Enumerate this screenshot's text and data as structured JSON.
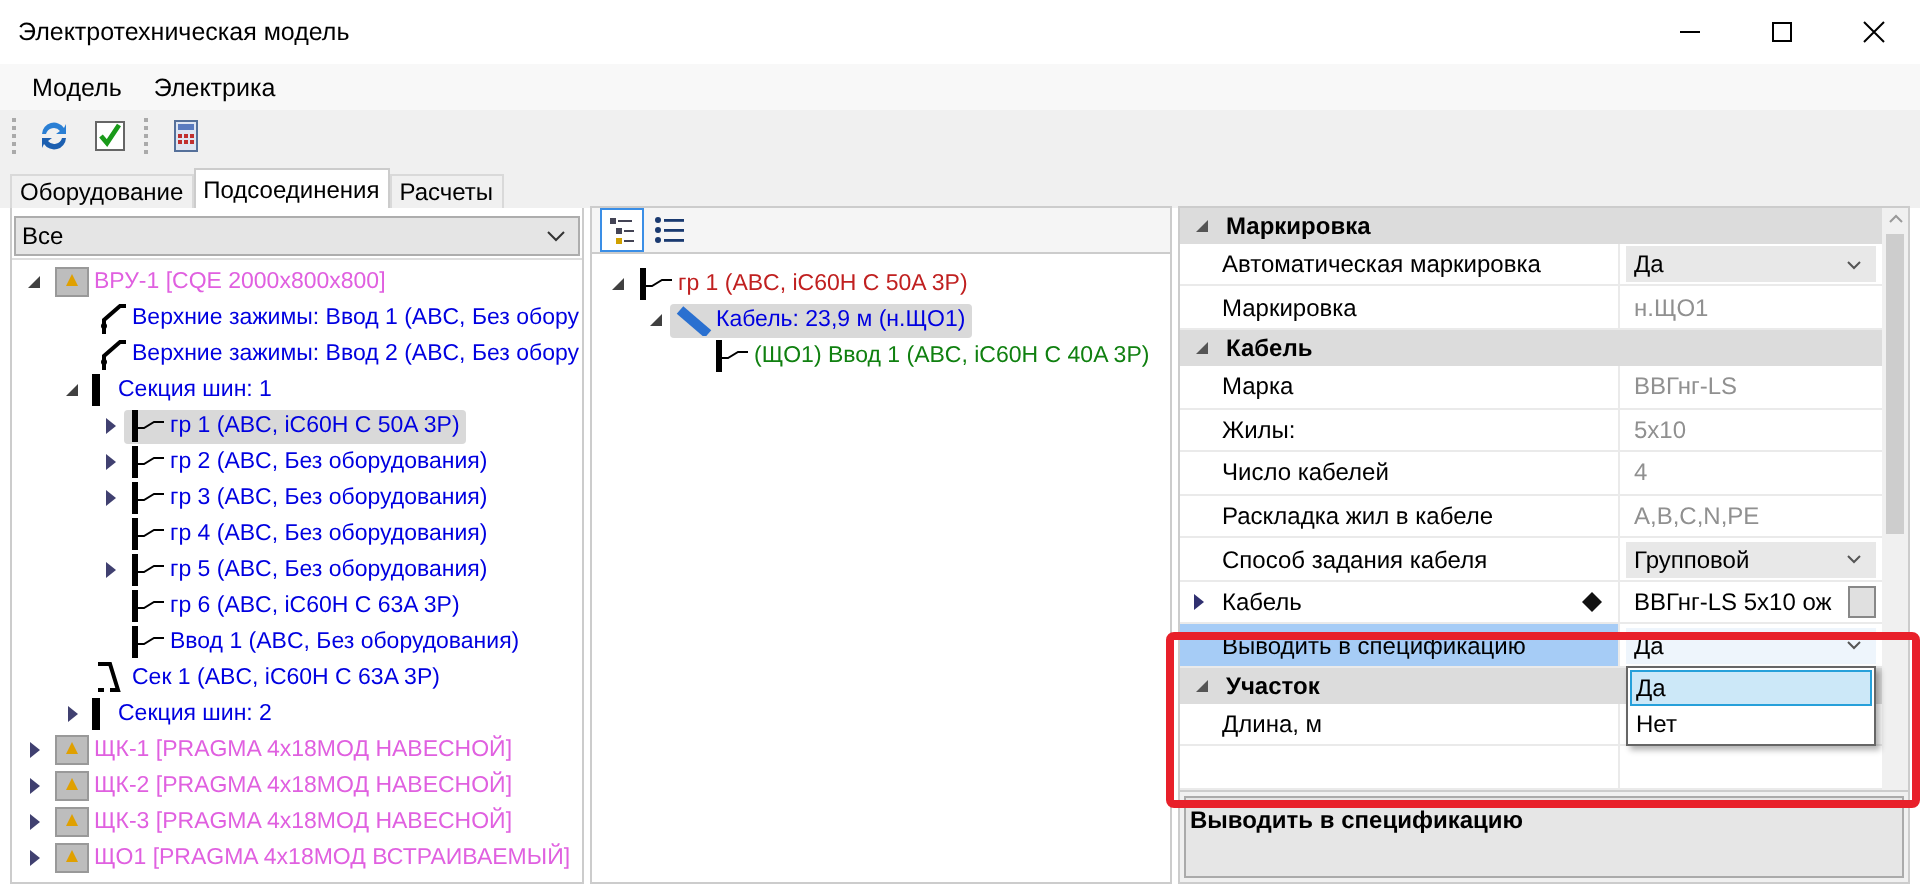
{
  "window": {
    "title": "Электротехническая модель"
  },
  "menu": [
    "Модель",
    "Электрика"
  ],
  "tabs": [
    {
      "label": "Оборудование",
      "selected": false
    },
    {
      "label": "Подсоединения",
      "selected": true
    },
    {
      "label": "Расчеты",
      "selected": false
    }
  ],
  "filter": {
    "value": "Все"
  },
  "equipment_tree": [
    {
      "label": "ВРУ-1 [CQE 2000x800x800]",
      "kind": "cabinet",
      "color": "#e060e0",
      "expanded": true,
      "selected": false,
      "children": [
        {
          "label": "Верхние зажимы: Ввод 1 (ABC, Без обору",
          "kind": "switch",
          "color": "#0000e0",
          "selected": false
        },
        {
          "label": "Верхние зажимы: Ввод 2 (ABC, Без обору",
          "kind": "switch",
          "color": "#0000e0",
          "selected": false
        },
        {
          "label": "Секция шин: 1",
          "kind": "busbar",
          "color": "#0000e0",
          "expanded": true,
          "selected": false,
          "children": [
            {
              "label": "гр 1 (ABC, iC60H C 50A 3P)",
              "kind": "breaker",
              "color": "#0000e0",
              "expanded": false,
              "selected": true
            },
            {
              "label": "гр 2 (ABC, Без оборудования)",
              "kind": "breaker",
              "color": "#0000e0",
              "expanded": false,
              "selected": false
            },
            {
              "label": "гр 3 (ABC, Без оборудования)",
              "kind": "breaker",
              "color": "#0000e0",
              "expanded": false,
              "selected": false
            },
            {
              "label": "гр 4 (ABC, Без оборудования)",
              "kind": "breaker",
              "color": "#0000e0",
              "selected": false
            },
            {
              "label": "гр 5 (ABC, Без оборудования)",
              "kind": "breaker",
              "color": "#0000e0",
              "expanded": false,
              "selected": false
            },
            {
              "label": "гр 6 (ABC, iC60H C 63A 3P)",
              "kind": "breaker",
              "color": "#0000e0",
              "selected": false
            },
            {
              "label": "Ввод 1 (ABC, Без оборудования)",
              "kind": "breaker",
              "color": "#0000e0",
              "selected": false
            }
          ]
        },
        {
          "label": "Сек 1 (ABC, iC60H C 63A 3P)",
          "kind": "sectionalizer",
          "color": "#0000e0",
          "selected": false
        },
        {
          "label": "Секция шин: 2",
          "kind": "busbar",
          "color": "#0000e0",
          "expanded": false,
          "selected": false
        }
      ]
    },
    {
      "label": "ЩК-1 [PRAGMA 4x18МОД НАВЕСНОЙ]",
      "kind": "cabinet",
      "color": "#e060e0",
      "expanded": false,
      "selected": false
    },
    {
      "label": "ЩК-2 [PRAGMA 4x18МОД НАВЕСНОЙ]",
      "kind": "cabinet",
      "color": "#e060e0",
      "expanded": false,
      "selected": false
    },
    {
      "label": "ЩК-3 [PRAGMA 4x18МОД НАВЕСНОЙ]",
      "kind": "cabinet",
      "color": "#e060e0",
      "expanded": false,
      "selected": false
    },
    {
      "label": "ЩО1 [PRAGMA 4x18МОД ВСТРАИВАЕМЫЙ]",
      "kind": "cabinet",
      "color": "#e060e0",
      "expanded": false,
      "selected": false
    }
  ],
  "connection_tree": [
    {
      "label": "гр 1 (ABC, iC60H C 50A 3P)",
      "kind": "breaker",
      "color": "#c02020",
      "expanded": true,
      "selected": false,
      "children": [
        {
          "label": "Кабель: 23,9 м (н.ЩО1)",
          "kind": "cable",
          "color": "#0000e0",
          "expanded": true,
          "selected": true,
          "children": [
            {
              "label": "(ЩО1) Ввод 1 (ABC, iC60H C 40A 3P)",
              "kind": "breaker",
              "color": "#108010",
              "selected": false
            }
          ]
        }
      ]
    }
  ],
  "properties": {
    "categories": [
      {
        "name": "Маркировка",
        "expanded": true,
        "rows": [
          {
            "name": "Автоматическая маркировка",
            "value": "Да",
            "kind": "dropdown",
            "selected": false,
            "open": false
          },
          {
            "name": "Маркировка",
            "value": "н.ЩО1",
            "kind": "text",
            "readonly": true,
            "selected": false
          }
        ]
      },
      {
        "name": "Кабель",
        "expanded": true,
        "rows": [
          {
            "name": "Марка",
            "value": "ВВГнг-LS",
            "kind": "text",
            "readonly": true,
            "selected": false
          },
          {
            "name": "Жилы:",
            "value": "5x10",
            "kind": "text",
            "readonly": true,
            "selected": false
          },
          {
            "name": "Число кабелей",
            "value": "4",
            "kind": "text",
            "readonly": true,
            "selected": false
          },
          {
            "name": "Раскладка жил в кабеле",
            "value": "A,B,C,N,PE",
            "kind": "text",
            "readonly": true,
            "selected": false
          },
          {
            "name": "Способ задания кабеля",
            "value": "Групповой",
            "kind": "dropdown",
            "selected": false,
            "open": false
          },
          {
            "name": "Кабель",
            "value": "ВВГнг-LS 5x10 ож",
            "kind": "object",
            "selected": false
          },
          {
            "name": "Выводить в спецификацию",
            "value": "Да",
            "kind": "dropdown",
            "selected": true,
            "open": true
          }
        ]
      },
      {
        "name": "Участок",
        "expanded": true,
        "rows": [
          {
            "name": "Длина, м",
            "kind": "text",
            "selected": false
          }
        ]
      }
    ],
    "dropdown_options": [
      {
        "label": "Да",
        "selected": true
      },
      {
        "label": "Нет",
        "selected": false
      }
    ],
    "description": "Выводить в спецификацию"
  }
}
